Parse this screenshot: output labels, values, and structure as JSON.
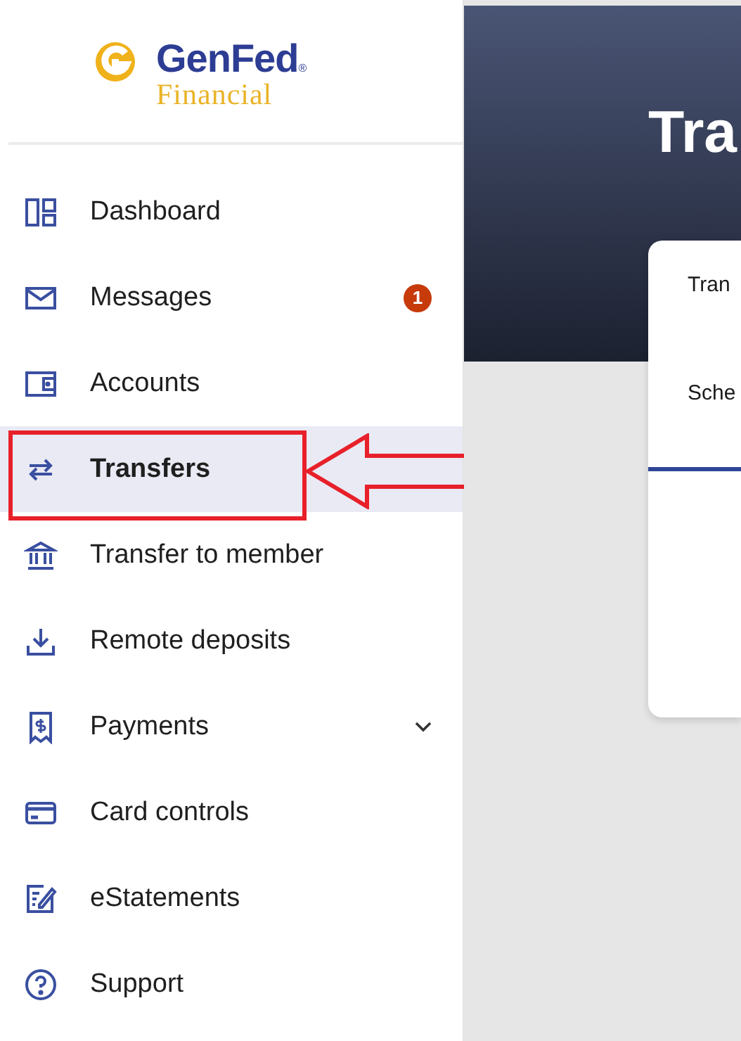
{
  "logo": {
    "name": "GenFed",
    "mark": "®",
    "tagline": "Financial"
  },
  "sidebar": {
    "items": [
      {
        "label": "Dashboard",
        "kind": "link",
        "selected": false
      },
      {
        "label": "Messages",
        "kind": "link",
        "selected": false,
        "badge": "1"
      },
      {
        "label": "Accounts",
        "kind": "link",
        "selected": false
      },
      {
        "label": "Transfers",
        "kind": "link",
        "selected": true
      },
      {
        "label": "Transfer to member",
        "kind": "link",
        "selected": false
      },
      {
        "label": "Remote deposits",
        "kind": "link",
        "selected": false
      },
      {
        "label": "Payments",
        "kind": "group",
        "selected": false,
        "expanded": false
      },
      {
        "label": "Card controls",
        "kind": "link",
        "selected": false
      },
      {
        "label": "eStatements",
        "kind": "link",
        "selected": false
      },
      {
        "label": "Support",
        "kind": "link",
        "selected": false
      }
    ]
  },
  "page": {
    "title": "Tra"
  },
  "card": {
    "items": [
      {
        "label": "Tran"
      },
      {
        "label": "Sche"
      }
    ]
  }
}
